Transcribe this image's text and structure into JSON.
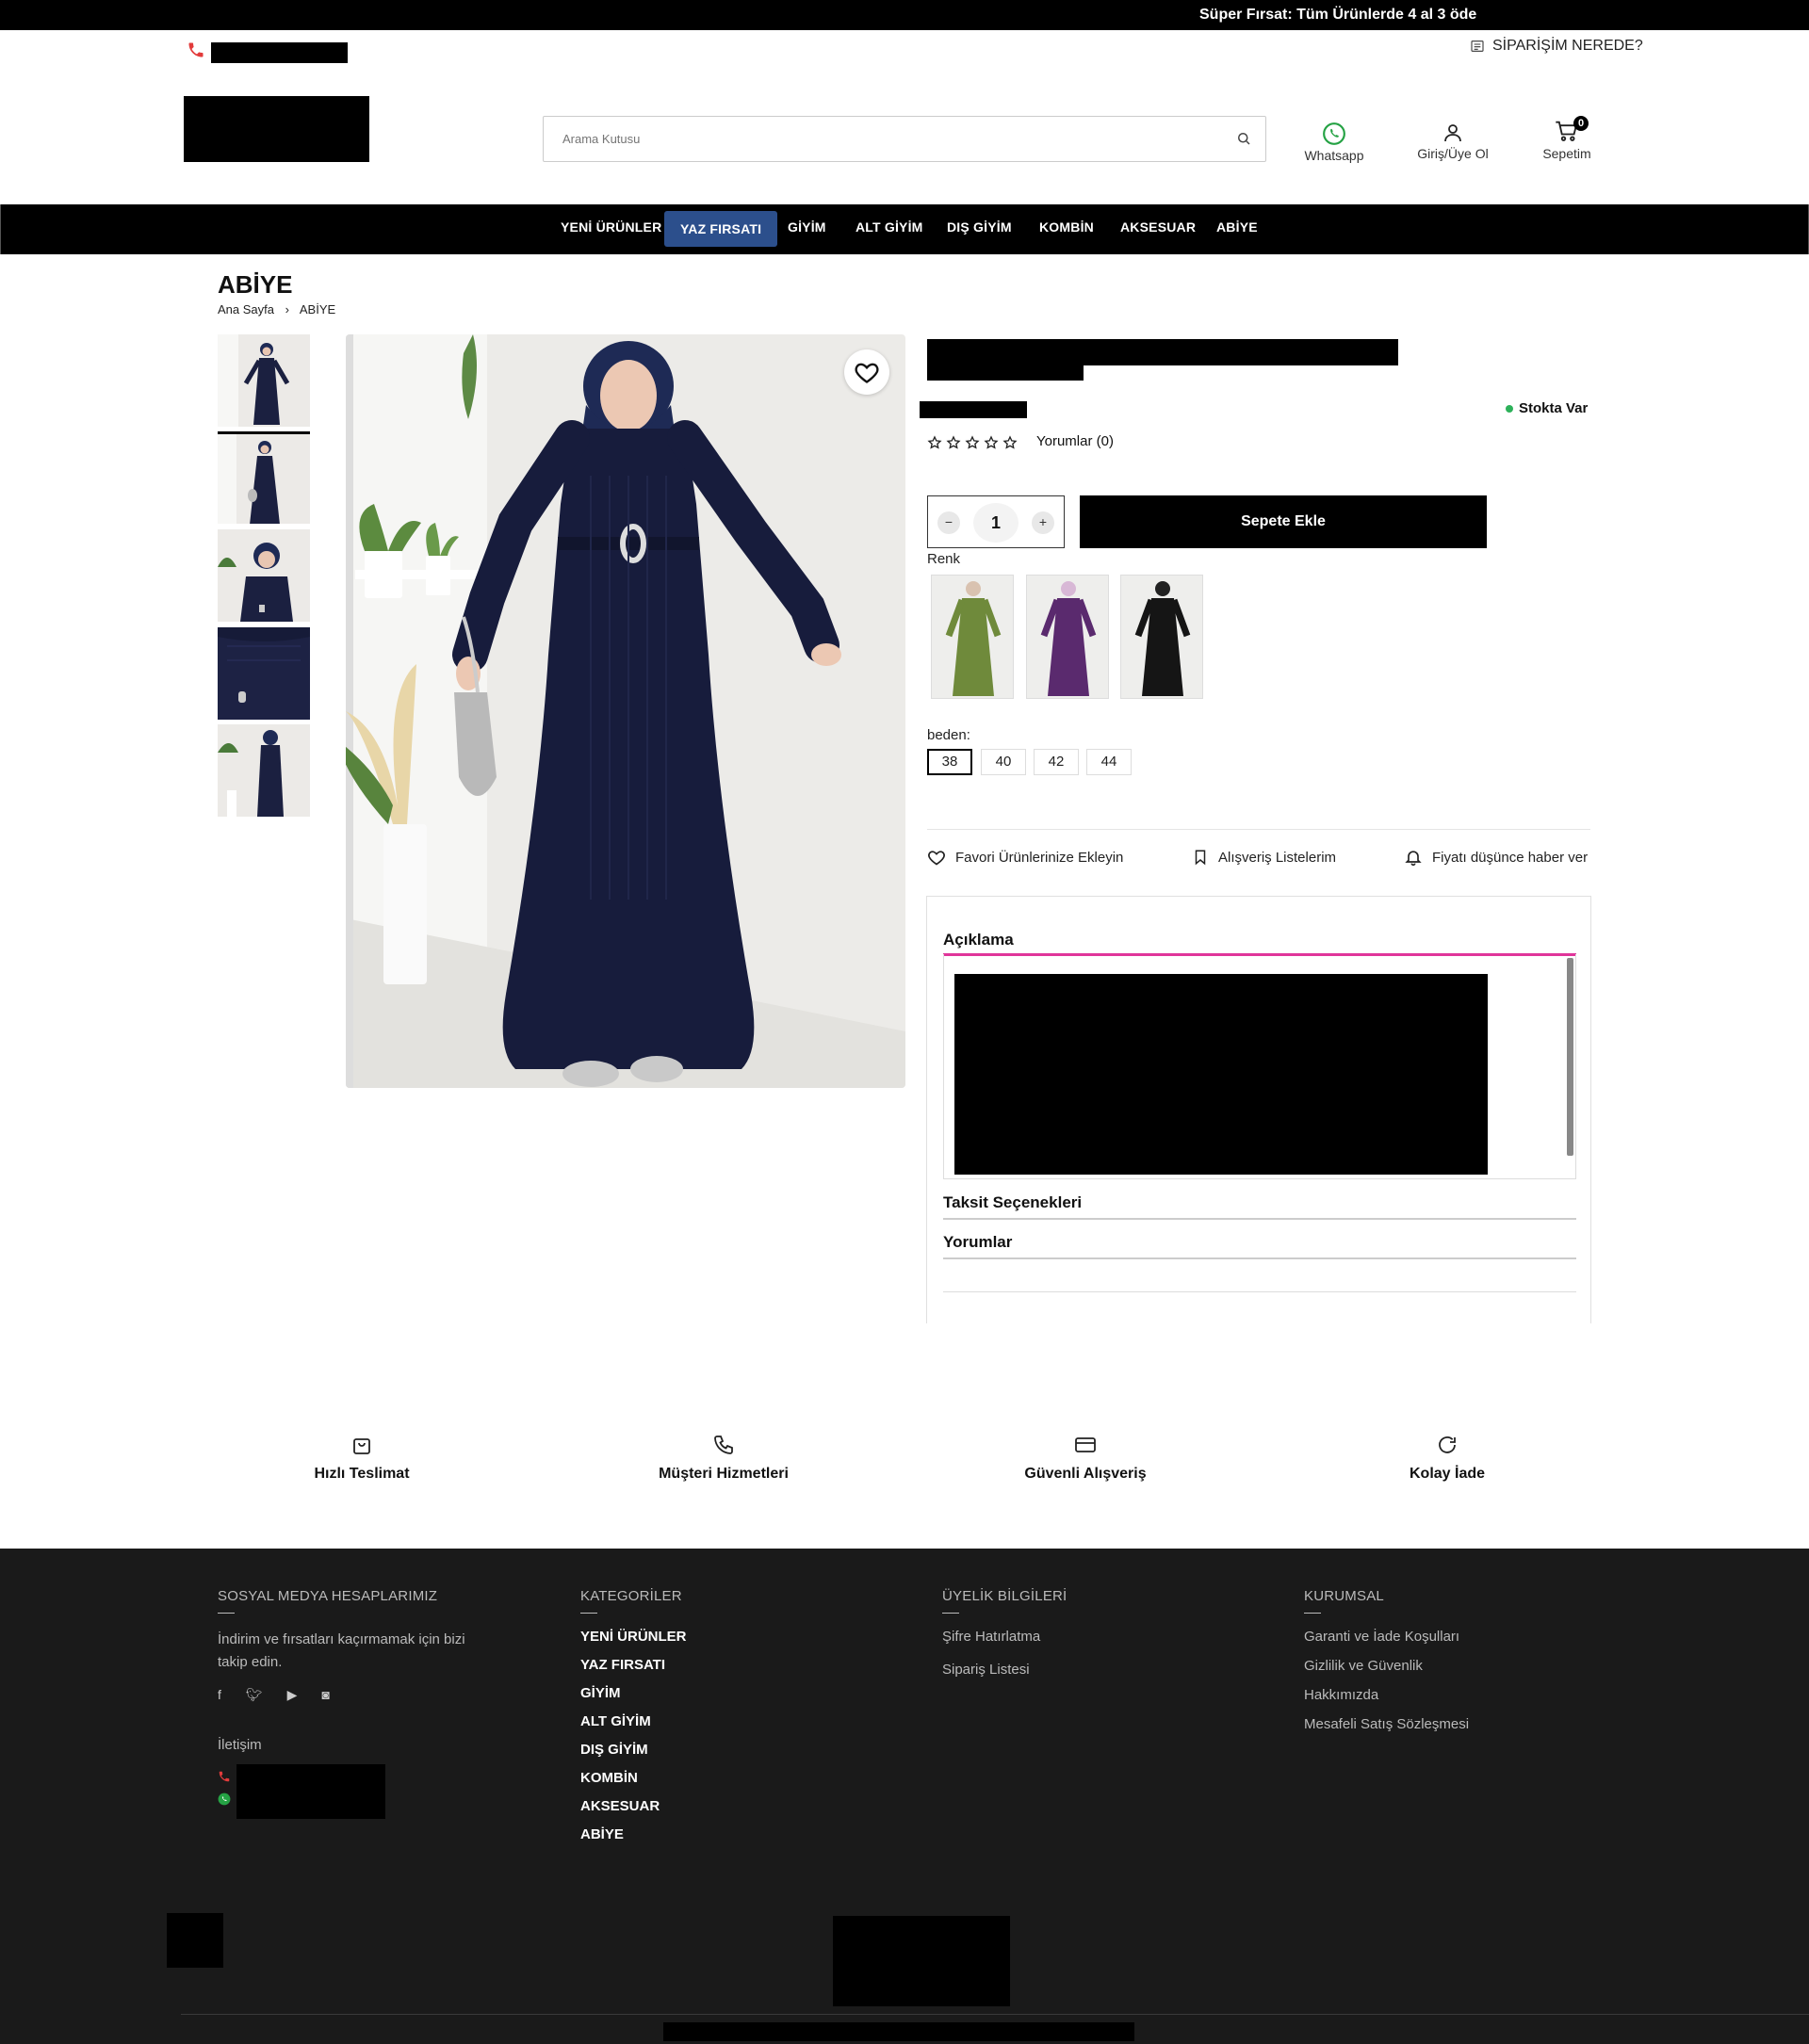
{
  "topbar": {
    "promo": "Süper Fırsat: Tüm Ürünlerde 4 al 3 öde"
  },
  "header": {
    "order_tracking": "SİPARİŞİM NEREDE?",
    "search_placeholder": "Arama Kutusu",
    "whatsapp": "Whatsapp",
    "login": "Giriş/Üye Ol",
    "cart": "Sepetim",
    "cart_count": "0"
  },
  "nav": {
    "items": [
      "YENİ ÜRÜNLER",
      "YAZ FIRSATI",
      "GİYİM",
      "ALT GİYİM",
      "DIŞ GİYİM",
      "KOMBİN",
      "AKSESUAR",
      "ABİYE"
    ],
    "active_index": 1
  },
  "page": {
    "title": "ABİYE",
    "breadcrumb": [
      "Ana Sayfa",
      "ABİYE"
    ]
  },
  "product": {
    "stock": "Stokta Var",
    "reviews_link": "Yorumlar (0)",
    "rating": 0,
    "rating_max": 5,
    "quantity": "1",
    "add_to_cart": "Sepete Ekle",
    "color_label": "Renk",
    "colors": [
      "green",
      "purple",
      "black"
    ],
    "size_label": "beden:",
    "sizes": [
      "38",
      "40",
      "42",
      "44"
    ],
    "selected_size": "38",
    "actions": {
      "favorite": "Favori Ürünlerinize Ekleyin",
      "lists": "Alışveriş Listelerim",
      "price_alert": "Fiyatı düşünce haber ver"
    },
    "tabs": {
      "description": "Açıklama",
      "installments": "Taksit Seçenekleri",
      "reviews": "Yorumlar"
    }
  },
  "features": [
    "Hızlı Teslimat",
    "Müşteri Hizmetleri",
    "Güvenli Alışveriş",
    "Kolay İade"
  ],
  "footer": {
    "social": {
      "title": "SOSYAL MEDYA HESAPLARIMIZ",
      "text": "İndirim ve fırsatları kaçırmamak için bizi takip edin.",
      "contact_title": "İletişim"
    },
    "categories": {
      "title": "KATEGORİLER",
      "items": [
        "YENİ ÜRÜNLER",
        "YAZ FIRSATI",
        "GİYİM",
        "ALT GİYİM",
        "DIŞ GİYİM",
        "KOMBİN",
        "AKSESUAR",
        "ABİYE"
      ]
    },
    "membership": {
      "title": "ÜYELİK BİLGİLERİ",
      "items": [
        "Şifre Hatırlatma",
        "Sipariş Listesi"
      ]
    },
    "corporate": {
      "title": "KURUMSAL",
      "items": [
        "Garanti ve İade Koşulları",
        "Gizlilik ve Güvenlik",
        "Hakkımızda",
        "Mesafeli Satış Sözleşmesi"
      ]
    }
  },
  "colors": {
    "nav_active": "#2c4f8c",
    "tab_accent": "#e0359a",
    "stock_dot": "#2db15a",
    "whatsapp": "#25a244",
    "footer_bg": "#1a1a1a"
  }
}
